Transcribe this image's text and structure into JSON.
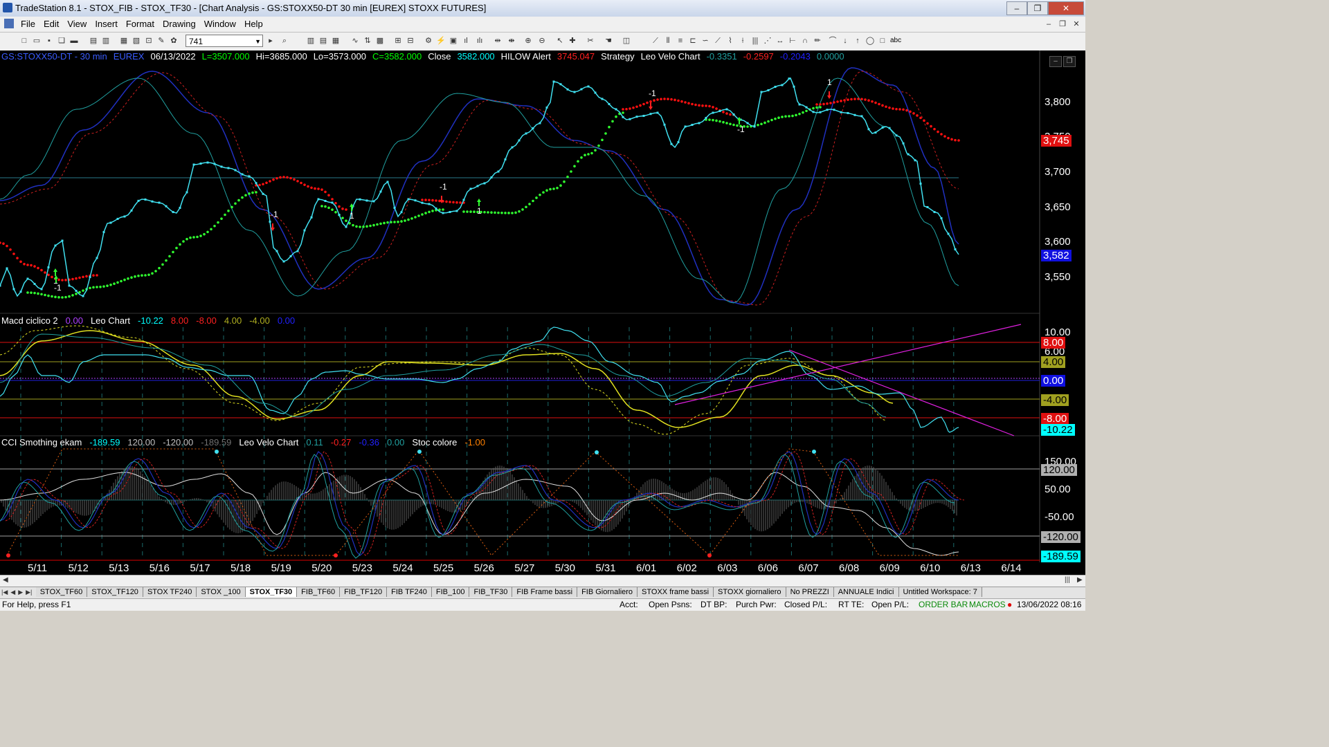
{
  "window": {
    "title": "TradeStation 8.1 - STOX_FIB - STOX_TF30 - [Chart Analysis - GS:STOXX50-DT  30 min  [EUREX] STOXX FUTURES]",
    "minimize": "‒",
    "restore": "❐",
    "close": "✕"
  },
  "menu": {
    "items": [
      "File",
      "Edit",
      "View",
      "Insert",
      "Format",
      "Drawing",
      "Window",
      "Help"
    ],
    "mdi_minimize": "‒",
    "mdi_restore": "❐",
    "mdi_close": "✕"
  },
  "toolbar": {
    "interval_value": "741",
    "text_tool_label": "abc"
  },
  "price_panel": {
    "header": [
      {
        "text": "GS:STOXX50-DT - 30 min",
        "color": "#3a5cff"
      },
      {
        "text": "EUREX",
        "color": "#3a5cff"
      },
      {
        "text": "06/13/2022",
        "color": "#ffffff"
      },
      {
        "text": "L=3507.000",
        "color": "#00ff00"
      },
      {
        "text": "Hi=3685.000",
        "color": "#ffffff"
      },
      {
        "text": "Lo=3573.000",
        "color": "#ffffff"
      },
      {
        "text": "C=3582.000",
        "color": "#00ff00"
      },
      {
        "text": "Close",
        "color": "#ffffff"
      },
      {
        "text": "3582.000",
        "color": "#00ffff"
      },
      {
        "text": "HILOW Alert",
        "color": "#ffffff"
      },
      {
        "text": "3745.047",
        "color": "#ff2020"
      },
      {
        "text": "Strategy",
        "color": "#ffffff"
      },
      {
        "text": "Leo Velo Chart",
        "color": "#ffffff"
      },
      {
        "text": "-0.3351",
        "color": "#20a0a0"
      },
      {
        "text": "-0.2597",
        "color": "#ff2020"
      },
      {
        "text": "-0.2043",
        "color": "#2020ff"
      },
      {
        "text": "0.0000",
        "color": "#20a0a0"
      }
    ],
    "axis": [
      "3,800",
      "3,750",
      "3,700",
      "3,650",
      "3,600",
      "3,550"
    ],
    "tag_red": "3,745",
    "tag_blue": "3,582",
    "signals": [
      "1",
      "-1",
      "1",
      "-1",
      "1",
      "-1",
      "-1",
      "1",
      "-1"
    ]
  },
  "macd_panel": {
    "header": [
      {
        "text": "Macd ciclico 2",
        "color": "#ffffff"
      },
      {
        "text": "0.00",
        "color": "#b040ff"
      },
      {
        "text": "Leo Chart",
        "color": "#ffffff"
      },
      {
        "text": "-10.22",
        "color": "#00ffff"
      },
      {
        "text": "8.00",
        "color": "#ff2020"
      },
      {
        "text": "-8.00",
        "color": "#ff2020"
      },
      {
        "text": "4.00",
        "color": "#b0b020"
      },
      {
        "text": "-4.00",
        "color": "#b0b020"
      },
      {
        "text": "0.00",
        "color": "#2020ff"
      }
    ],
    "axis": [
      "10.00",
      "6.00"
    ],
    "tags": [
      {
        "text": "8.00",
        "bg": "#e01010",
        "fg": "#ffffff"
      },
      {
        "text": "4.00",
        "bg": "#a0a020",
        "fg": "#000000"
      },
      {
        "text": "0.00",
        "bg": "#1010e0",
        "fg": "#ffffff"
      },
      {
        "text": "-4.00",
        "bg": "#a0a020",
        "fg": "#000000"
      },
      {
        "text": "-8.00",
        "bg": "#e01010",
        "fg": "#ffffff"
      },
      {
        "text": "-10.22",
        "bg": "#00ffff",
        "fg": "#000000"
      }
    ]
  },
  "cci_panel": {
    "header": [
      {
        "text": "CCI Smothing ekam",
        "color": "#ffffff"
      },
      {
        "text": "-189.59",
        "color": "#00ffff"
      },
      {
        "text": "120.00",
        "color": "#c0c0c0"
      },
      {
        "text": "-120.00",
        "color": "#c0c0c0"
      },
      {
        "text": "-189.59",
        "color": "#707070"
      },
      {
        "text": "Leo Velo Chart",
        "color": "#ffffff"
      },
      {
        "text": "0.11",
        "color": "#20a0a0"
      },
      {
        "text": "-0.27",
        "color": "#ff2020"
      },
      {
        "text": "-0.36",
        "color": "#2020ff"
      },
      {
        "text": "0.00",
        "color": "#20a0a0"
      },
      {
        "text": "Stoc colore",
        "color": "#ffffff"
      },
      {
        "text": "-1.00",
        "color": "#ff8000"
      }
    ],
    "axis": [
      "150.00",
      "50.00",
      "-50.00"
    ],
    "tags": [
      {
        "text": "120.00",
        "bg": "#b0b0b0",
        "fg": "#000000"
      },
      {
        "text": "-120.00",
        "bg": "#b0b0b0",
        "fg": "#000000"
      },
      {
        "text": "-189.59",
        "bg": "#00ffff",
        "fg": "#000000"
      }
    ]
  },
  "dates": [
    "5/11",
    "5/12",
    "5/13",
    "5/16",
    "5/17",
    "5/18",
    "5/19",
    "5/20",
    "5/23",
    "5/24",
    "5/25",
    "5/26",
    "5/27",
    "5/30",
    "5/31",
    "6/01",
    "6/02",
    "6/03",
    "6/06",
    "6/07",
    "6/08",
    "6/09",
    "6/10",
    "6/13",
    "6/14"
  ],
  "tabs": [
    "STOX_TF60",
    "STOX_TF120",
    "STOX TF240",
    "STOX _100",
    "STOX_TF30",
    "FIB_TF60",
    "FIB_TF120",
    "FIB TF240",
    "FIB_100",
    "FIB_TF30",
    "FIB Frame bassi",
    "FIB Giornaliero",
    "STOXX frame bassi",
    "STOXX giornaliero",
    "No PREZZI",
    "ANNUALE Indici",
    "Untitled Workspace: 7"
  ],
  "active_tab": "STOX_TF30",
  "status": {
    "help": "For Help, press F1",
    "acct": "Acct:",
    "open_psns": "Open Psns:",
    "dt_bp": "DT BP:",
    "purch_pwr": "Purch Pwr:",
    "closed_pl": "Closed P/L:",
    "rt_te": "RT TE:",
    "open_pl": "Open P/L:",
    "order_bar": "ORDER BAR",
    "macros": "MACROS",
    "datetime": "13/06/2022 08:16"
  },
  "colors": {
    "chart_bg": "#000000",
    "price": "#40e0f0",
    "trend_up": "#30ff30",
    "trend_down": "#ff1010",
    "wave_blue": "#2030c0",
    "wave_teal": "#20a0a0",
    "wave_red": "#d02020",
    "macd_yellow": "#e0e020",
    "trendline": "#e020e0",
    "cci_white": "#e0e0e0",
    "cci_orange": "#e06010"
  }
}
